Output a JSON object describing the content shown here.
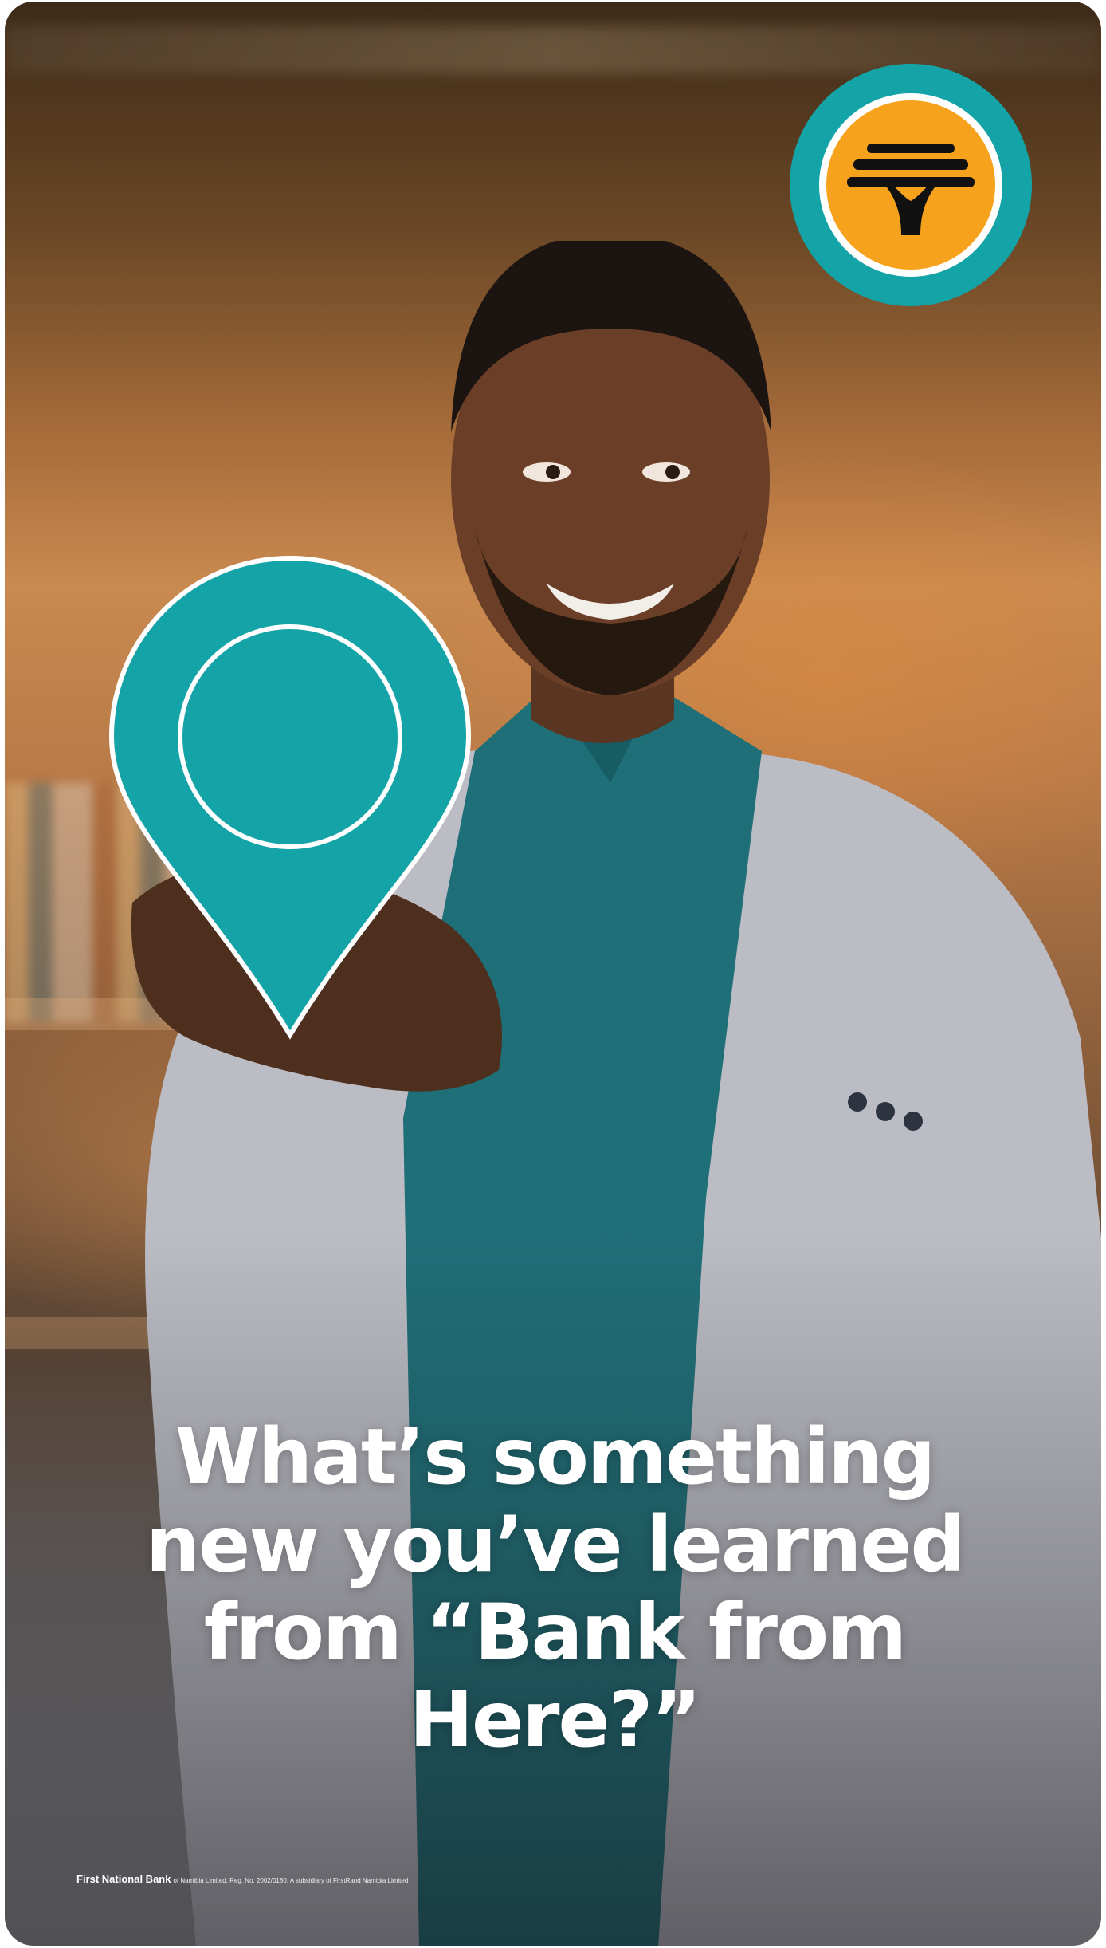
{
  "headline": {
    "line1": "What’s something",
    "line2": "new you’ve learned",
    "line3": "from “Bank from",
    "line4": "Here?”"
  },
  "footer": {
    "brand": "First National Bank",
    "legal": "of Namibia Limited. Reg. No. 2002/0180. A subsidiary of FirstRand Namibia Limited"
  },
  "colors": {
    "teal": "#14A3A6",
    "orange": "#F7A21C",
    "white": "#FFFFFF",
    "black": "#111111"
  },
  "icons": {
    "logo": "fnb-tree-logo-icon",
    "pin": "location-pin-icon"
  }
}
